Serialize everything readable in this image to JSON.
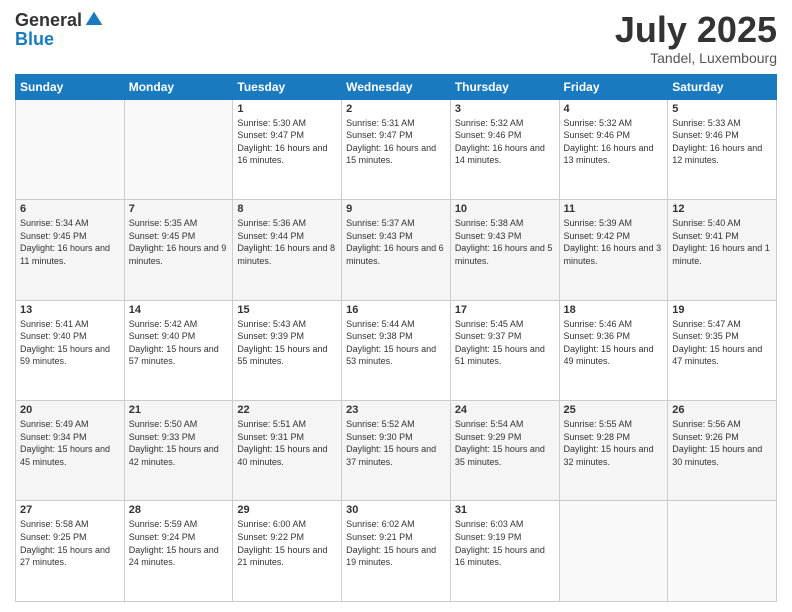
{
  "header": {
    "logo_general": "General",
    "logo_blue": "Blue",
    "title": "July 2025",
    "subtitle": "Tandel, Luxembourg"
  },
  "weekdays": [
    "Sunday",
    "Monday",
    "Tuesday",
    "Wednesday",
    "Thursday",
    "Friday",
    "Saturday"
  ],
  "weeks": [
    [
      {
        "day": "",
        "sunrise": "",
        "sunset": "",
        "daylight": ""
      },
      {
        "day": "",
        "sunrise": "",
        "sunset": "",
        "daylight": ""
      },
      {
        "day": "1",
        "sunrise": "Sunrise: 5:30 AM",
        "sunset": "Sunset: 9:47 PM",
        "daylight": "Daylight: 16 hours and 16 minutes."
      },
      {
        "day": "2",
        "sunrise": "Sunrise: 5:31 AM",
        "sunset": "Sunset: 9:47 PM",
        "daylight": "Daylight: 16 hours and 15 minutes."
      },
      {
        "day": "3",
        "sunrise": "Sunrise: 5:32 AM",
        "sunset": "Sunset: 9:46 PM",
        "daylight": "Daylight: 16 hours and 14 minutes."
      },
      {
        "day": "4",
        "sunrise": "Sunrise: 5:32 AM",
        "sunset": "Sunset: 9:46 PM",
        "daylight": "Daylight: 16 hours and 13 minutes."
      },
      {
        "day": "5",
        "sunrise": "Sunrise: 5:33 AM",
        "sunset": "Sunset: 9:46 PM",
        "daylight": "Daylight: 16 hours and 12 minutes."
      }
    ],
    [
      {
        "day": "6",
        "sunrise": "Sunrise: 5:34 AM",
        "sunset": "Sunset: 9:45 PM",
        "daylight": "Daylight: 16 hours and 11 minutes."
      },
      {
        "day": "7",
        "sunrise": "Sunrise: 5:35 AM",
        "sunset": "Sunset: 9:45 PM",
        "daylight": "Daylight: 16 hours and 9 minutes."
      },
      {
        "day": "8",
        "sunrise": "Sunrise: 5:36 AM",
        "sunset": "Sunset: 9:44 PM",
        "daylight": "Daylight: 16 hours and 8 minutes."
      },
      {
        "day": "9",
        "sunrise": "Sunrise: 5:37 AM",
        "sunset": "Sunset: 9:43 PM",
        "daylight": "Daylight: 16 hours and 6 minutes."
      },
      {
        "day": "10",
        "sunrise": "Sunrise: 5:38 AM",
        "sunset": "Sunset: 9:43 PM",
        "daylight": "Daylight: 16 hours and 5 minutes."
      },
      {
        "day": "11",
        "sunrise": "Sunrise: 5:39 AM",
        "sunset": "Sunset: 9:42 PM",
        "daylight": "Daylight: 16 hours and 3 minutes."
      },
      {
        "day": "12",
        "sunrise": "Sunrise: 5:40 AM",
        "sunset": "Sunset: 9:41 PM",
        "daylight": "Daylight: 16 hours and 1 minute."
      }
    ],
    [
      {
        "day": "13",
        "sunrise": "Sunrise: 5:41 AM",
        "sunset": "Sunset: 9:40 PM",
        "daylight": "Daylight: 15 hours and 59 minutes."
      },
      {
        "day": "14",
        "sunrise": "Sunrise: 5:42 AM",
        "sunset": "Sunset: 9:40 PM",
        "daylight": "Daylight: 15 hours and 57 minutes."
      },
      {
        "day": "15",
        "sunrise": "Sunrise: 5:43 AM",
        "sunset": "Sunset: 9:39 PM",
        "daylight": "Daylight: 15 hours and 55 minutes."
      },
      {
        "day": "16",
        "sunrise": "Sunrise: 5:44 AM",
        "sunset": "Sunset: 9:38 PM",
        "daylight": "Daylight: 15 hours and 53 minutes."
      },
      {
        "day": "17",
        "sunrise": "Sunrise: 5:45 AM",
        "sunset": "Sunset: 9:37 PM",
        "daylight": "Daylight: 15 hours and 51 minutes."
      },
      {
        "day": "18",
        "sunrise": "Sunrise: 5:46 AM",
        "sunset": "Sunset: 9:36 PM",
        "daylight": "Daylight: 15 hours and 49 minutes."
      },
      {
        "day": "19",
        "sunrise": "Sunrise: 5:47 AM",
        "sunset": "Sunset: 9:35 PM",
        "daylight": "Daylight: 15 hours and 47 minutes."
      }
    ],
    [
      {
        "day": "20",
        "sunrise": "Sunrise: 5:49 AM",
        "sunset": "Sunset: 9:34 PM",
        "daylight": "Daylight: 15 hours and 45 minutes."
      },
      {
        "day": "21",
        "sunrise": "Sunrise: 5:50 AM",
        "sunset": "Sunset: 9:33 PM",
        "daylight": "Daylight: 15 hours and 42 minutes."
      },
      {
        "day": "22",
        "sunrise": "Sunrise: 5:51 AM",
        "sunset": "Sunset: 9:31 PM",
        "daylight": "Daylight: 15 hours and 40 minutes."
      },
      {
        "day": "23",
        "sunrise": "Sunrise: 5:52 AM",
        "sunset": "Sunset: 9:30 PM",
        "daylight": "Daylight: 15 hours and 37 minutes."
      },
      {
        "day": "24",
        "sunrise": "Sunrise: 5:54 AM",
        "sunset": "Sunset: 9:29 PM",
        "daylight": "Daylight: 15 hours and 35 minutes."
      },
      {
        "day": "25",
        "sunrise": "Sunrise: 5:55 AM",
        "sunset": "Sunset: 9:28 PM",
        "daylight": "Daylight: 15 hours and 32 minutes."
      },
      {
        "day": "26",
        "sunrise": "Sunrise: 5:56 AM",
        "sunset": "Sunset: 9:26 PM",
        "daylight": "Daylight: 15 hours and 30 minutes."
      }
    ],
    [
      {
        "day": "27",
        "sunrise": "Sunrise: 5:58 AM",
        "sunset": "Sunset: 9:25 PM",
        "daylight": "Daylight: 15 hours and 27 minutes."
      },
      {
        "day": "28",
        "sunrise": "Sunrise: 5:59 AM",
        "sunset": "Sunset: 9:24 PM",
        "daylight": "Daylight: 15 hours and 24 minutes."
      },
      {
        "day": "29",
        "sunrise": "Sunrise: 6:00 AM",
        "sunset": "Sunset: 9:22 PM",
        "daylight": "Daylight: 15 hours and 21 minutes."
      },
      {
        "day": "30",
        "sunrise": "Sunrise: 6:02 AM",
        "sunset": "Sunset: 9:21 PM",
        "daylight": "Daylight: 15 hours and 19 minutes."
      },
      {
        "day": "31",
        "sunrise": "Sunrise: 6:03 AM",
        "sunset": "Sunset: 9:19 PM",
        "daylight": "Daylight: 15 hours and 16 minutes."
      },
      {
        "day": "",
        "sunrise": "",
        "sunset": "",
        "daylight": ""
      },
      {
        "day": "",
        "sunrise": "",
        "sunset": "",
        "daylight": ""
      }
    ]
  ]
}
